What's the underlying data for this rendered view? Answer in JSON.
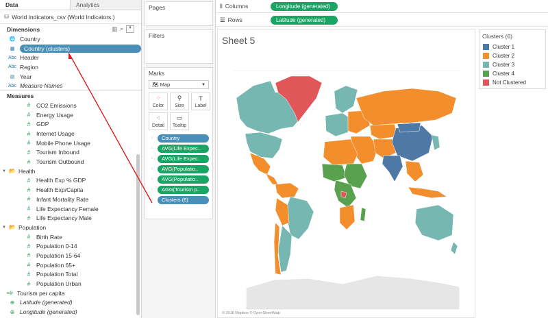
{
  "tabs": {
    "data": "Data",
    "analytics": "Analytics"
  },
  "datasource": "World Indicators_csv (World Indicators.)",
  "dimensions": {
    "title": "Dimensions",
    "items": [
      {
        "label": "Country",
        "icon": "globe-icon",
        "glyph": "🌐"
      },
      {
        "label": "Country (clusters)",
        "icon": "cluster-icon",
        "glyph": "▦",
        "selected": true
      },
      {
        "label": "Header",
        "icon": "abc-icon",
        "glyph": "Abc"
      },
      {
        "label": "Region",
        "icon": "abc-icon",
        "glyph": "Abc"
      },
      {
        "label": "Year",
        "icon": "calendar-icon",
        "glyph": "▤"
      },
      {
        "label": "Measure Names",
        "icon": "abc-icon",
        "glyph": "Abc",
        "italic": true
      }
    ]
  },
  "measures": {
    "title": "Measures",
    "items": [
      {
        "type": "measure",
        "label": "CO2 Emissions"
      },
      {
        "type": "measure",
        "label": "Energy Usage"
      },
      {
        "type": "measure",
        "label": "GDP"
      },
      {
        "type": "measure",
        "label": "Internet Usage"
      },
      {
        "type": "measure",
        "label": "Mobile Phone Usage"
      },
      {
        "type": "measure",
        "label": "Tourism Inbound"
      },
      {
        "type": "measure",
        "label": "Tourism Outbound"
      },
      {
        "type": "folder",
        "label": "Health"
      },
      {
        "type": "measure",
        "label": "Health Exp % GDP"
      },
      {
        "type": "measure",
        "label": "Health Exp/Capita"
      },
      {
        "type": "measure",
        "label": "Infant Mortality Rate"
      },
      {
        "type": "measure",
        "label": "Life Expectancy Female"
      },
      {
        "type": "measure",
        "label": "Life Expectancy Male"
      },
      {
        "type": "folder",
        "label": "Population"
      },
      {
        "type": "measure",
        "label": "Birth Rate"
      },
      {
        "type": "measure",
        "label": "Population 0-14"
      },
      {
        "type": "measure",
        "label": "Population 15-64"
      },
      {
        "type": "measure",
        "label": "Population 65+"
      },
      {
        "type": "measure",
        "label": "Population Total"
      },
      {
        "type": "measure",
        "label": "Population Urban"
      },
      {
        "type": "calc",
        "label": "Tourism per capita"
      },
      {
        "type": "geo",
        "label": "Latitude (generated)",
        "italic": true
      },
      {
        "type": "geo",
        "label": "Longitude (generated)",
        "italic": true
      }
    ]
  },
  "pages": "Pages",
  "filters": "Filters",
  "marks": {
    "title": "Marks",
    "type": "Map",
    "buttons": [
      {
        "label": "Color",
        "icon": "color-icon"
      },
      {
        "label": "Size",
        "icon": "size-icon"
      },
      {
        "label": "Label",
        "icon": "label-icon"
      },
      {
        "label": "Detail",
        "icon": "detail-icon"
      },
      {
        "label": "Tooltip",
        "icon": "tooltip-icon"
      }
    ],
    "pills": [
      {
        "label": "Country",
        "style": "blue",
        "icon": "detail-icon"
      },
      {
        "label": "AVG(Life Expec..",
        "style": "green",
        "icon": "detail-icon"
      },
      {
        "label": "AVG(Life Expec..",
        "style": "green",
        "icon": "detail-icon"
      },
      {
        "label": "AVG(Populatio..",
        "style": "green",
        "icon": "detail-icon"
      },
      {
        "label": "AVG(Populatio..",
        "style": "green",
        "icon": "detail-icon"
      },
      {
        "label": "AGG(Tourism p..",
        "style": "green",
        "icon": "detail-icon"
      },
      {
        "label": "Clusters (6)",
        "style": "blue",
        "icon": "color-icon"
      }
    ]
  },
  "shelves": {
    "columns_label": "Columns",
    "columns_pill": "Longitude (generated)",
    "rows_label": "Rows",
    "rows_pill": "Latitude (generated)"
  },
  "sheet_title": "Sheet 5",
  "copyright": "© 2018 Mapbox © OpenStreetMap",
  "legend": {
    "title": "Clusters (6)",
    "items": [
      {
        "label": "Cluster 1",
        "color": "#4e79a7"
      },
      {
        "label": "Cluster 2",
        "color": "#f28e2b"
      },
      {
        "label": "Cluster 3",
        "color": "#76b7b2"
      },
      {
        "label": "Cluster 4",
        "color": "#59a14f"
      },
      {
        "label": "Not Clustered",
        "color": "#e15759"
      }
    ]
  },
  "colors": {
    "accent_green": "#1aa565",
    "accent_blue": "#4a8fb8",
    "annotation": "#d42020"
  }
}
